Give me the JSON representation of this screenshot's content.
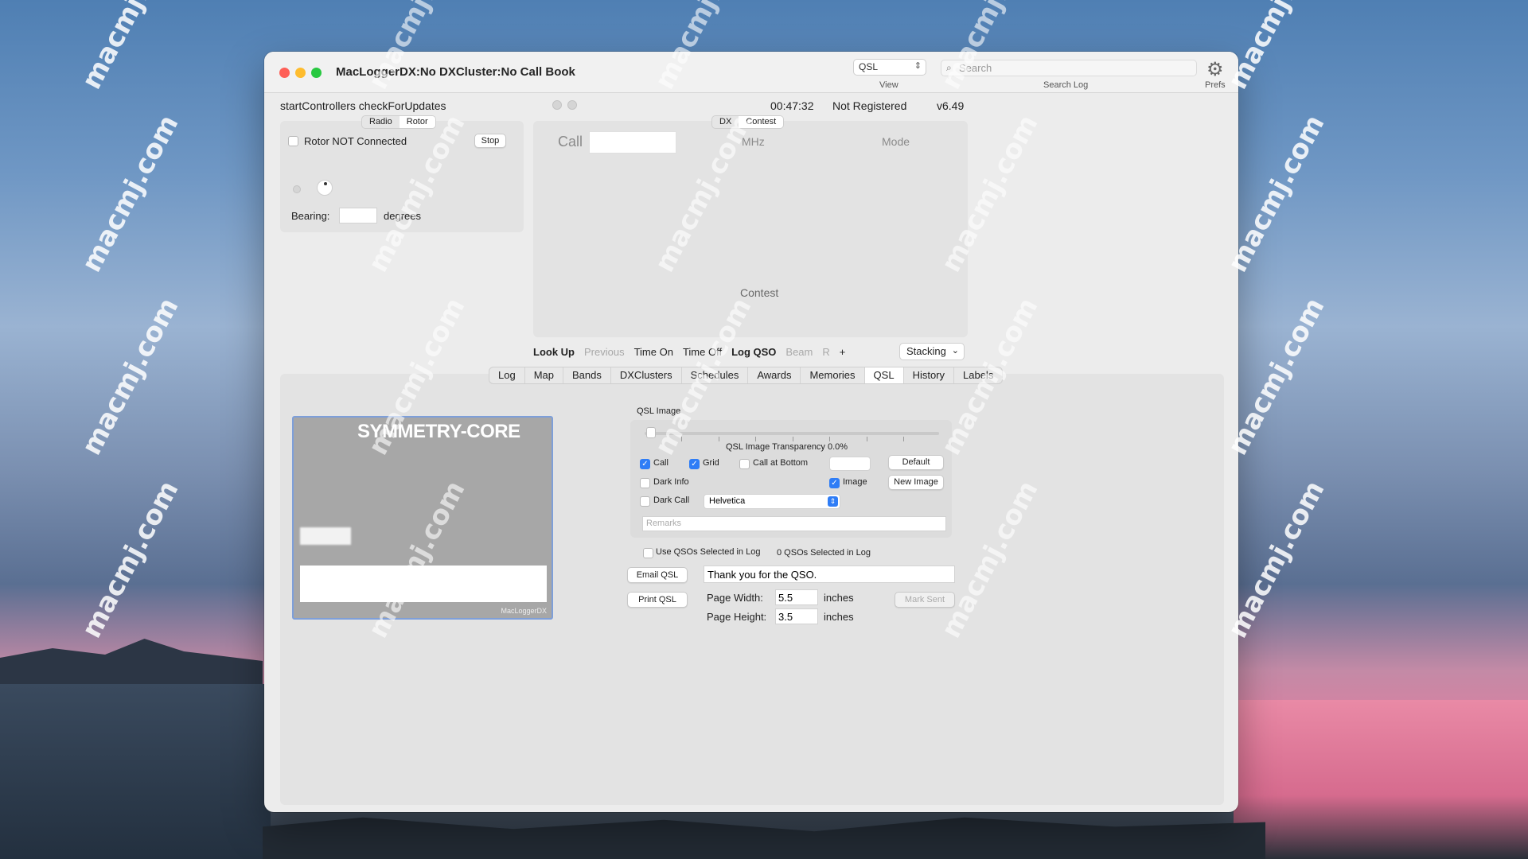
{
  "window": {
    "title": "MacLoggerDX:No DXCluster:No Call Book",
    "view_select": "QSL",
    "view_caption": "View",
    "search_placeholder": "Search",
    "search_caption": "Search Log",
    "prefs_caption": "Prefs"
  },
  "status": {
    "message": "startControllers checkForUpdates",
    "time": "00:47:32",
    "registration": "Not Registered",
    "version": "v6.49"
  },
  "rotor_panel": {
    "tabs": [
      "Radio",
      "Rotor"
    ],
    "selected_tab": "Rotor",
    "rotor_label": "Rotor NOT Connected",
    "stop_button": "Stop",
    "bearing_label": "Bearing:",
    "bearing_value": "",
    "degrees_label": "degrees"
  },
  "dx_panel": {
    "tabs": [
      "DX",
      "Contest"
    ],
    "selected_tab": "Contest",
    "call_label": "Call",
    "call_value": "",
    "mhz_label": "MHz",
    "mode_label": "Mode",
    "contest_label": "Contest"
  },
  "actions": {
    "look_up": "Look Up",
    "previous": "Previous",
    "time_on": "Time On",
    "time_off": "Time Off",
    "log_qso": "Log QSO",
    "beam": "Beam",
    "r": "R",
    "plus": "+",
    "stacking": "Stacking"
  },
  "main_tabs": [
    "Log",
    "Map",
    "Bands",
    "DXClusters",
    "Schedules",
    "Awards",
    "Memories",
    "QSL",
    "History",
    "Labels"
  ],
  "selected_main_tab": "QSL",
  "qsl": {
    "card_title": "SYMMETRY-CORE",
    "card_brand": "MacLoggerDX",
    "image_group_label": "QSL Image",
    "transparency_label": "QSL Image Transparency 0.0%",
    "call_chk": "Call",
    "call_checked": true,
    "grid_chk": "Grid",
    "grid_checked": true,
    "call_bottom_chk": "Call at Bottom",
    "call_bottom_checked": false,
    "default_button": "Default",
    "dark_info_chk": "Dark Info",
    "dark_info_checked": false,
    "image_chk": "Image",
    "image_checked": true,
    "new_image_button": "New Image",
    "dark_call_chk": "Dark Call",
    "dark_call_checked": false,
    "font_select": "Helvetica",
    "remarks_placeholder": "Remarks",
    "use_qsos_chk": "Use QSOs Selected in Log",
    "use_qsos_checked": false,
    "qsos_selected": "0 QSOs Selected in Log",
    "email_button": "Email QSL",
    "message_value": "Thank you for the QSO.",
    "print_button": "Print QSL",
    "page_width_label": "Page Width:",
    "page_width_value": "5.5",
    "page_height_label": "Page Height:",
    "page_height_value": "3.5",
    "inches_label": "inches",
    "mark_sent_button": "Mark Sent"
  },
  "watermark": "macmj.com"
}
